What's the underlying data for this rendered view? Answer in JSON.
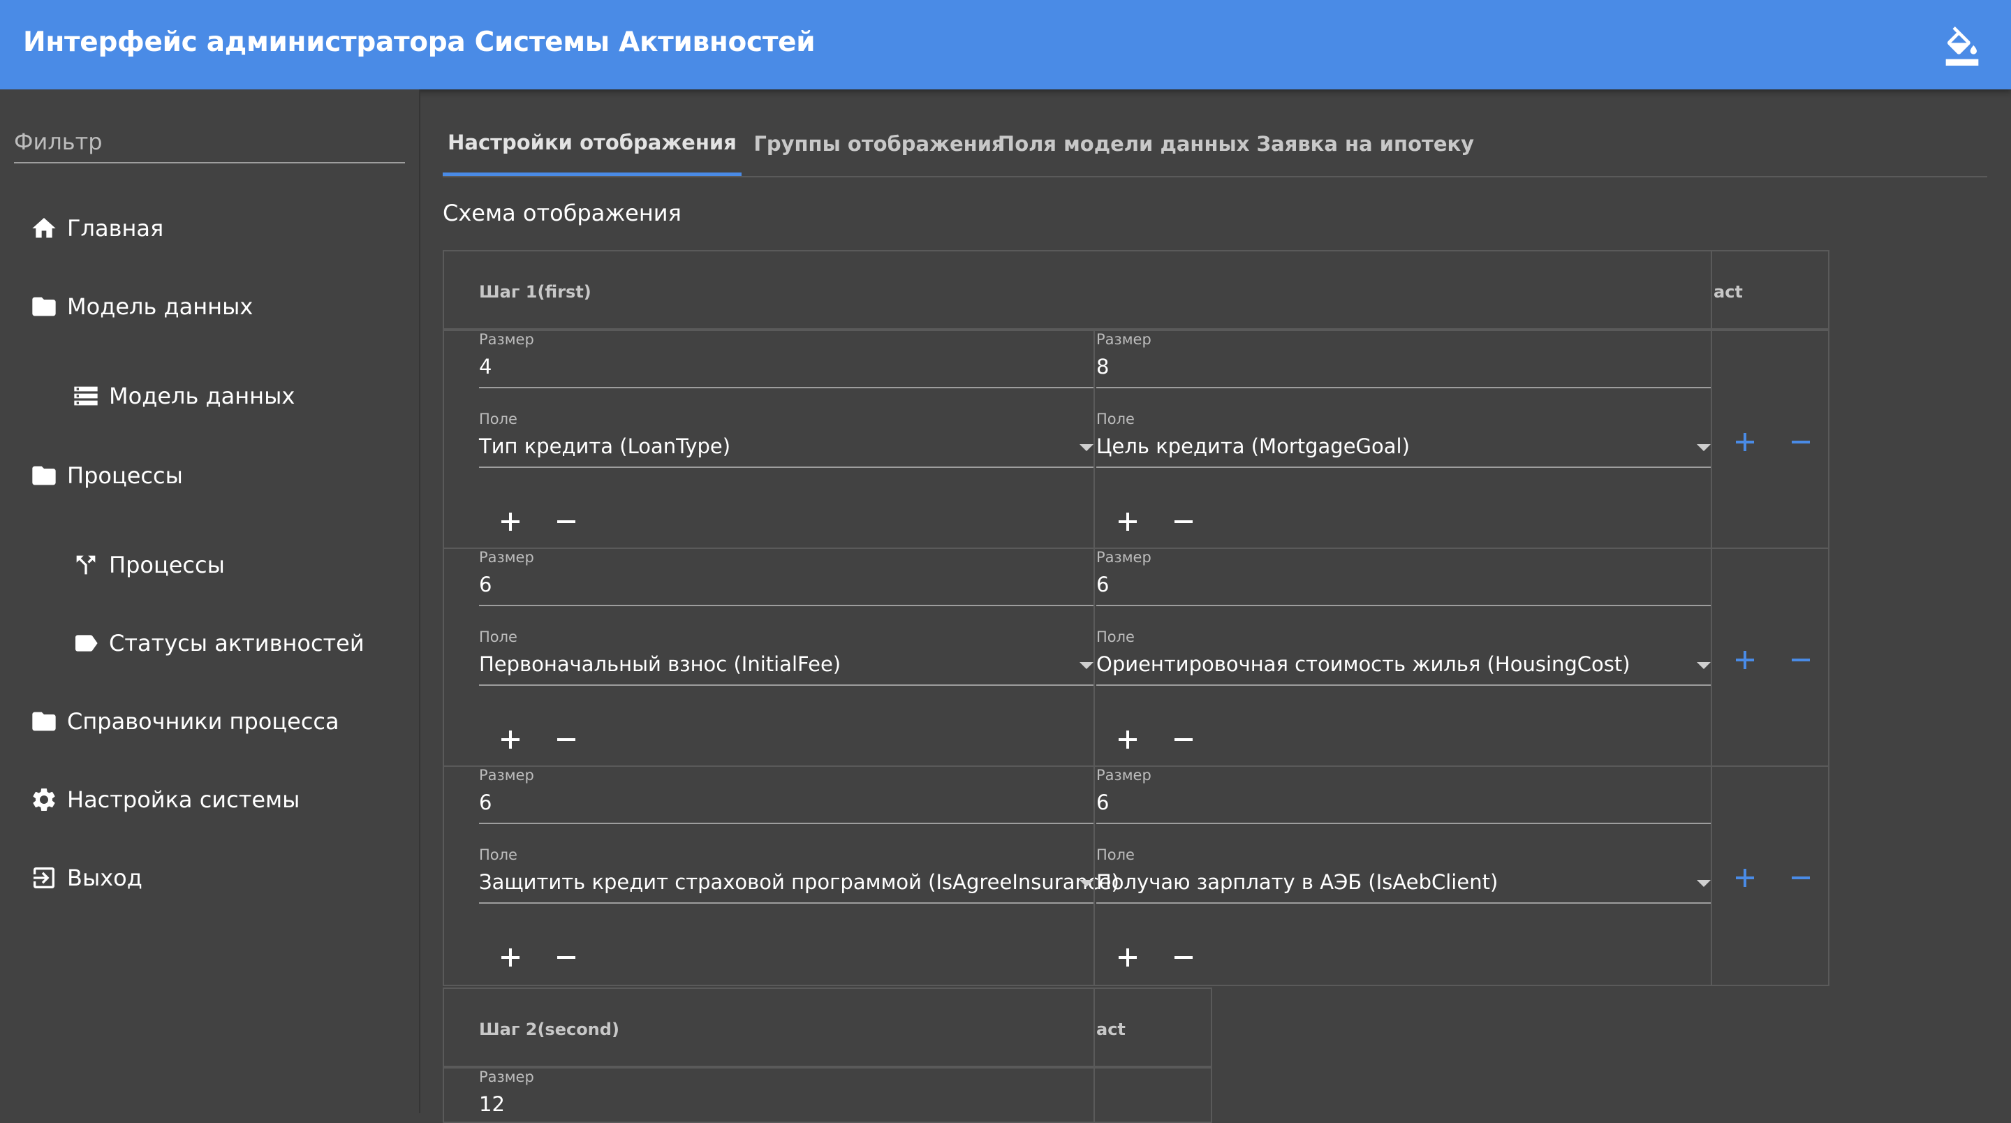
{
  "app": {
    "title": "Интерфейс администратора Системы Активностей",
    "accent": "#4a8be6",
    "theme_icon": "paint-bucket-icon"
  },
  "sidebar": {
    "filter_placeholder": "Фильтр",
    "items": [
      {
        "label": "Главная",
        "icon": "home-icon"
      },
      {
        "label": "Модель данных",
        "icon": "folder-icon"
      },
      {
        "label": "Модель данных",
        "icon": "storage-icon"
      },
      {
        "label": "Процессы",
        "icon": "folder-icon"
      },
      {
        "label": "Процессы",
        "icon": "merge-icon"
      },
      {
        "label": "Статусы активностей",
        "icon": "label-icon"
      },
      {
        "label": "Справочники процесса",
        "icon": "folder-icon"
      },
      {
        "label": "Настройка системы",
        "icon": "gear-icon"
      },
      {
        "label": "Выход",
        "icon": "exit-icon"
      }
    ]
  },
  "tabs": [
    {
      "label": "Настройки отображения",
      "active": true
    },
    {
      "label": "Группы отображения",
      "active": false
    },
    {
      "label": "Поля модели данных Заявка на ипотеку",
      "active": false
    }
  ],
  "section_title": "Схема отображения",
  "schema": {
    "size_label": "Размер",
    "field_label": "Поле",
    "act_label": "act",
    "steps": [
      {
        "header": "Шаг 1(first)",
        "rows": [
          {
            "cells": [
              {
                "size": "4",
                "field": "Тип кредита (LoanType)"
              },
              {
                "size": "8",
                "field": "Цель кредита (MortgageGoal)"
              }
            ]
          },
          {
            "cells": [
              {
                "size": "6",
                "field": "Первоначальный взнос (InitialFee)"
              },
              {
                "size": "6",
                "field": "Ориентировочная стоимость жилья (HousingCost)"
              }
            ]
          },
          {
            "cells": [
              {
                "size": "6",
                "field": "Защитить кредит страховой программой (IsAgreeInsurance)"
              },
              {
                "size": "6",
                "field": "Получаю зарплату в АЭБ (IsAebClient)"
              }
            ]
          }
        ]
      },
      {
        "header": "Шаг 2(second)",
        "rows": [
          {
            "cells": [
              {
                "size": "12",
                "field": ""
              }
            ]
          }
        ]
      }
    ]
  }
}
